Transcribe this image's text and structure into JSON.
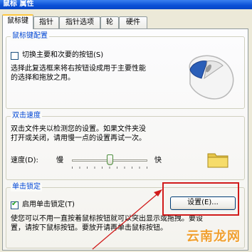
{
  "window": {
    "title": "鼠标 属性"
  },
  "tabs": [
    {
      "label": "鼠标键",
      "active": true
    },
    {
      "label": "指针"
    },
    {
      "label": "指针选项"
    },
    {
      "label": "轮"
    },
    {
      "label": "硬件"
    }
  ],
  "button_config": {
    "title": "鼠标键配置",
    "switch_label": "切换主要和次要的按钮(S)",
    "switch_checked": false,
    "description_line1": "选择此复选框来将右按钮设成用于主要性能",
    "description_line2": "的选择和拖放之用。"
  },
  "double_click": {
    "title": "双击速度",
    "description_line1": "双击文件夹以检测您的设置。如果文件夹没",
    "description_line2": "打开或关闭，请用慢一点的设置再试一次。",
    "speed_label": "速度(D):",
    "slow_label": "慢",
    "fast_label": "快",
    "slider_value": 0.5
  },
  "click_lock": {
    "title": "单击锁定",
    "enable_label": "启用单击锁定(T)",
    "enable_checked": true,
    "settings_button": "设置(E)...",
    "description_line1": "使您可以不用一直按着鼠标按钮就可以突出显示或拖拽。要设",
    "description_line2": "置，请按下鼠标按钮。要放开请再单击鼠标按钮。"
  },
  "watermark": "云南龙网",
  "colors": {
    "accent": "#0046d5",
    "highlight": "#d11b1b",
    "watermark": "#f0a030"
  }
}
